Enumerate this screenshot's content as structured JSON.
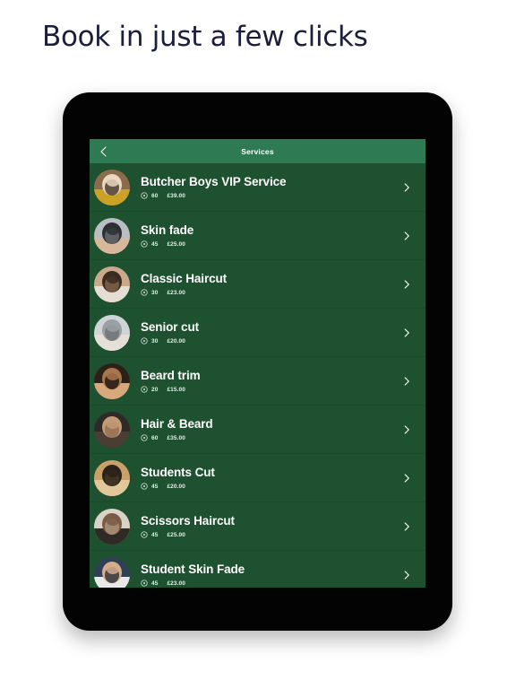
{
  "headline": "Book in just a few clicks",
  "colors": {
    "page_background": "#ffffff",
    "headline_text": "#1b1f3b",
    "device_frame": "#030303",
    "app_header_green": "#2e7a52",
    "list_green": "#1d5130",
    "divider_green": "#1a4a2c",
    "text_white": "#ffffff"
  },
  "app": {
    "header": {
      "back_icon": "chevron-left-icon",
      "title": "Services"
    },
    "services": [
      {
        "name": "Butcher Boys VIP Service",
        "duration": "60",
        "price": "£39.00",
        "clock_icon": "clock-icon",
        "chevron_icon": "chevron-right-icon",
        "avatar": "service-photo"
      },
      {
        "name": "Skin fade",
        "duration": "45",
        "price": "£25.00",
        "clock_icon": "clock-icon",
        "chevron_icon": "chevron-right-icon",
        "avatar": "service-photo"
      },
      {
        "name": "Classic Haircut",
        "duration": "30",
        "price": "£23.00",
        "clock_icon": "clock-icon",
        "chevron_icon": "chevron-right-icon",
        "avatar": "service-photo"
      },
      {
        "name": "Senior cut",
        "duration": "30",
        "price": "£20.00",
        "clock_icon": "clock-icon",
        "chevron_icon": "chevron-right-icon",
        "avatar": "service-photo"
      },
      {
        "name": "Beard trim",
        "duration": "20",
        "price": "£15.00",
        "clock_icon": "clock-icon",
        "chevron_icon": "chevron-right-icon",
        "avatar": "service-photo"
      },
      {
        "name": "Hair & Beard",
        "duration": "60",
        "price": "£35.00",
        "clock_icon": "clock-icon",
        "chevron_icon": "chevron-right-icon",
        "avatar": "service-photo"
      },
      {
        "name": "Students Cut",
        "duration": "45",
        "price": "£20.00",
        "clock_icon": "clock-icon",
        "chevron_icon": "chevron-right-icon",
        "avatar": "service-photo"
      },
      {
        "name": "Scissors Haircut",
        "duration": "45",
        "price": "£25.00",
        "clock_icon": "clock-icon",
        "chevron_icon": "chevron-right-icon",
        "avatar": "service-photo"
      },
      {
        "name": "Student Skin Fade",
        "duration": "45",
        "price": "£23.00",
        "clock_icon": "clock-icon",
        "chevron_icon": "chevron-right-icon",
        "avatar": "service-photo"
      }
    ]
  }
}
